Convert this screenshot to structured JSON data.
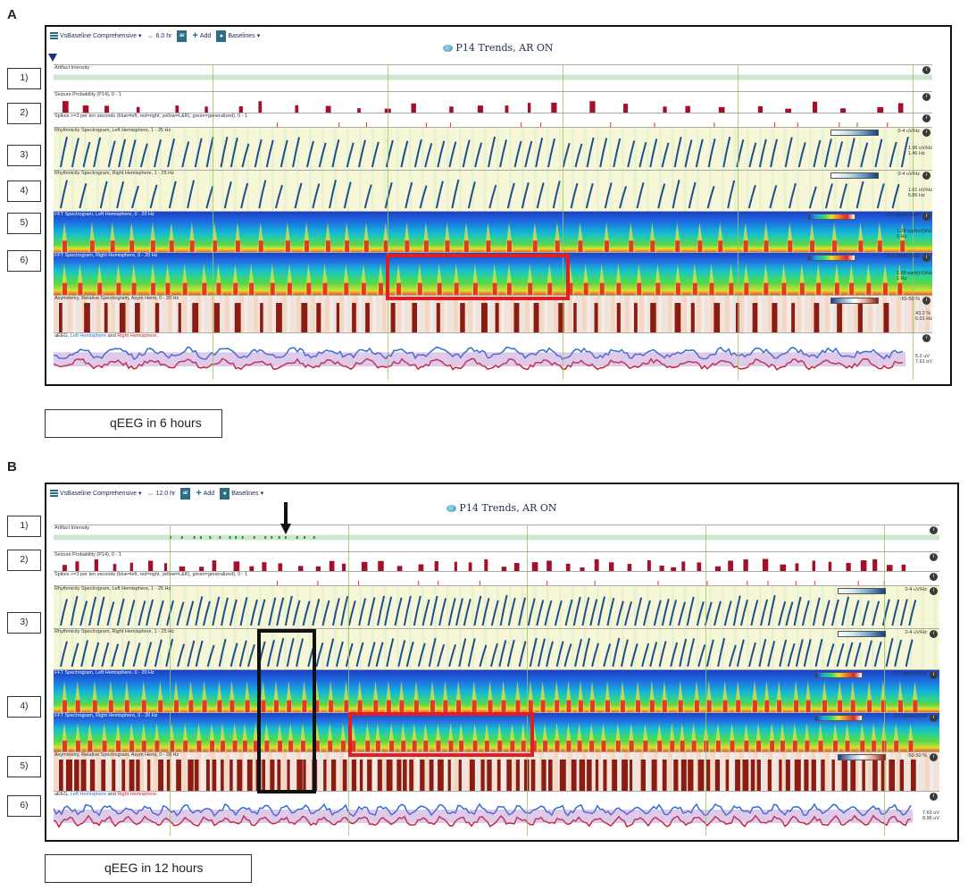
{
  "panels": [
    {
      "letter": "A",
      "toolbar": {
        "menu": "VsBaseline Comprehensive",
        "hours": "6.0 hr",
        "ar": "ar",
        "add": "Add",
        "baselines": "Baselines"
      },
      "title": "P14 Trends, AR ON",
      "caption": "qEEG in 6 hours",
      "tracks": {
        "artifact": "Artifact Intensity",
        "seizure": "Seizure Probability (P14), 0 - 1",
        "spikes": "Spikes >=3 per ten seconds (blue=left, red=right, yellow=L&R), green=generalized), 0 - 1",
        "rhythm_left": "Rhythmicity Spectrogram, Left Hemisphere, 1 - 25 Hz",
        "rhythm_right": "Rhythmicity Spectrogram, Right Hemisphere, 1 - 25 Hz",
        "fft_left": "FFT Spectrogram, Left Hemisphere, 0 - 20 Hz",
        "fft_right": "FFT Spectrogram, Right Hemisphere, 0 - 20 Hz",
        "asym": "Asymmetry, Relative Spectrogram, Asym Hemi, 0 - 20 Hz",
        "aeeg_prefix": "aEEG, ",
        "aeeg_left": "Left Hemisphere",
        "aeeg_and": " and ",
        "aeeg_right": "Right Hemisphere",
        "aeeg_suffix": "."
      },
      "scales": {
        "rhythm": "0-4 uV/Hz",
        "fft": "0-2 sqrt(uV)/Hz",
        "asym": "-50-50 %"
      },
      "right_values": {
        "rhythm_left": "1.96 uV/Hz\n1.46 Hz",
        "rhythm_right": "1.61 uV/Hz\n5.86 Hz",
        "fft_left": "1.28 sqrt(uV)/Hz\n1 Hz",
        "fft_right": "1.88 sqrt(uV)/Hz\n1 Hz",
        "asym": "43.2 %\n6.01 Hz",
        "aeeg": "5.2 uV\n7.61 uV"
      }
    },
    {
      "letter": "B",
      "toolbar": {
        "menu": "VsBaseline Comprehensive",
        "hours": "12.0 hr",
        "ar": "ar",
        "add": "Add",
        "baselines": "Baselines"
      },
      "title": "P14 Trends, AR ON",
      "caption": "qEEG in 12 hours",
      "tracks": {
        "artifact": "Artifact Intensity",
        "seizure": "Seizure Probability (P14), 0 - 1",
        "spikes": "Spikes >=3 per ten seconds (blue=left, red=right, yellow=L&R), green=generalized), 0 - 1",
        "rhythm_left": "Rhythmicity Spectrogram, Left Hemisphere, 1 - 25 Hz",
        "rhythm_right": "Rhythmicity Spectrogram, Right Hemisphere, 1 - 25 Hz",
        "fft_left": "FFT Spectrogram, Left Hemisphere, 0 - 20 Hz",
        "fft_right": "FFT Spectrogram, Right Hemisphere, 0 - 20 Hz",
        "asym": "Asymmetry, Relative Spectrogram, Asym Hemi, 0 - 20 Hz",
        "aeeg_prefix": "aEEG, ",
        "aeeg_left": "Left Hemisphere",
        "aeeg_and": " and ",
        "aeeg_right": "Right Hemisphere",
        "aeeg_suffix": "."
      },
      "scales": {
        "rhythm": "0-4 uV/Hz",
        "fft": "0-2 sqrt(uV)/Hz",
        "asym": "-50-50 %"
      },
      "right_values": {
        "aeeg": "7.63 uV\n8.96 uV"
      }
    }
  ],
  "row_labels": [
    "1)",
    "2)",
    "3)",
    "4)",
    "5)",
    "6)"
  ],
  "icons": {
    "info": "info-icon",
    "menu": "menu-icon",
    "arrows": "arrows-icon",
    "ar": "ar-icon",
    "add": "plus-icon",
    "baselines": "bulb-icon",
    "brain": "brain-icon"
  },
  "colors": {
    "seizure_bar": "#a3102a",
    "highlight": "#e01e26",
    "grid": "#9ec45a",
    "left": "#2a6ed6",
    "right": "#c81e2a",
    "overlap": "#a46ac0"
  }
}
